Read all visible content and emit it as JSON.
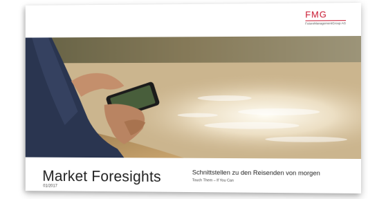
{
  "logo": {
    "mark": "FMG",
    "company": "FutureManagementGroup AG"
  },
  "cover": {
    "title": "Market Foresights",
    "issue": "01/2017",
    "subtitle": "Schnittstellen zu den Reisenden von morgen",
    "tagline": "Touch Them – If You Can"
  },
  "colors": {
    "brand": "#c8142d",
    "text": "#222222"
  }
}
